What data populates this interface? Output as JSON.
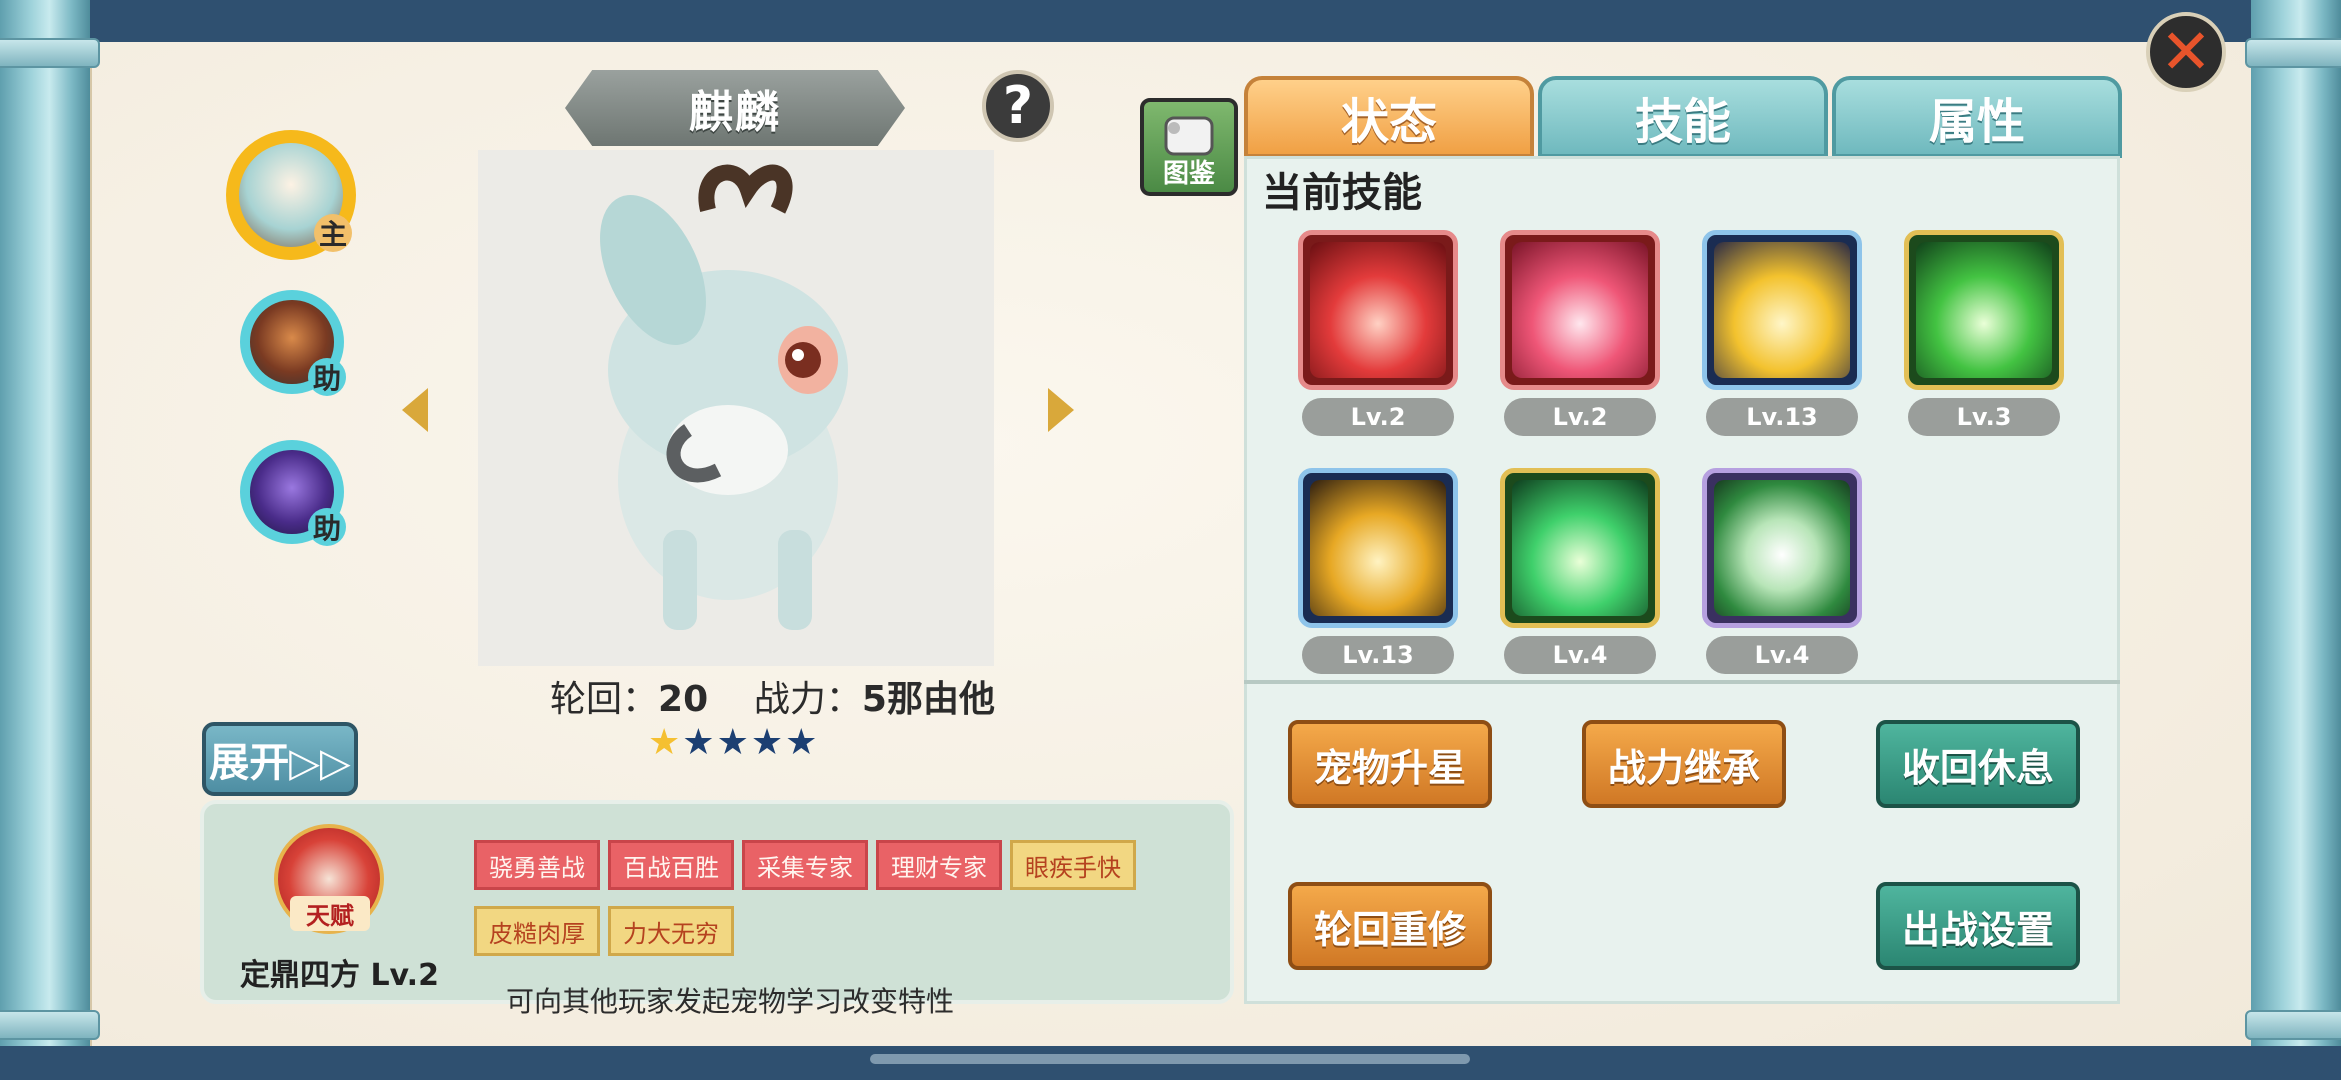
{
  "pet": {
    "name": "麒麟",
    "reincarnation_label": "轮回：",
    "reincarnation_value": "20",
    "power_label": "战力：",
    "power_value": "5那由他",
    "stars_filled": 1,
    "stars_total": 5
  },
  "pet_list": [
    {
      "role": "主",
      "color": "#f6b91b"
    },
    {
      "role": "助",
      "color": "#5ad1dc"
    },
    {
      "role": "助",
      "color": "#5ad1dc"
    }
  ],
  "buttons": {
    "expand": "展开▷▷",
    "help": "?",
    "pokedex": "图鉴",
    "close": "✕"
  },
  "tabs": [
    {
      "label": "状态",
      "active": true
    },
    {
      "label": "技能",
      "active": false
    },
    {
      "label": "属性",
      "active": false
    }
  ],
  "skills_section": {
    "title": "当前技能",
    "skills": [
      {
        "level": "Lv.2",
        "frame": "red",
        "icon": "sword-red-icon"
      },
      {
        "level": "Lv.2",
        "frame": "red",
        "icon": "heart-red-icon"
      },
      {
        "level": "Lv.13",
        "frame": "blue",
        "icon": "heart-gold-icon"
      },
      {
        "level": "Lv.3",
        "frame": "gold",
        "icon": "sword-green-icon"
      },
      {
        "level": "Lv.13",
        "frame": "blue",
        "icon": "sword-gold-icon"
      },
      {
        "level": "Lv.4",
        "frame": "gold",
        "icon": "heart-green-icon"
      },
      {
        "level": "Lv.4",
        "frame": "purple",
        "icon": "shield-green-icon"
      }
    ]
  },
  "actions": {
    "upgrade_star": "宠物升星",
    "inherit_power": "战力继承",
    "recall_rest": "收回休息",
    "reincarnate": "轮回重修",
    "battle_settings": "出战设置"
  },
  "talent": {
    "emblem_text": "天赋",
    "name": "定鼎四方 Lv.2",
    "traits": [
      {
        "label": "骁勇善战",
        "style": "red"
      },
      {
        "label": "百战百胜",
        "style": "red"
      },
      {
        "label": "采集专家",
        "style": "red"
      },
      {
        "label": "理财专家",
        "style": "red"
      },
      {
        "label": "眼疾手快",
        "style": "gold"
      },
      {
        "label": "皮糙肉厚",
        "style": "gold"
      },
      {
        "label": "力大无穷",
        "style": "gold"
      }
    ],
    "hint": "可向其他玩家发起宠物学习改变特性"
  }
}
